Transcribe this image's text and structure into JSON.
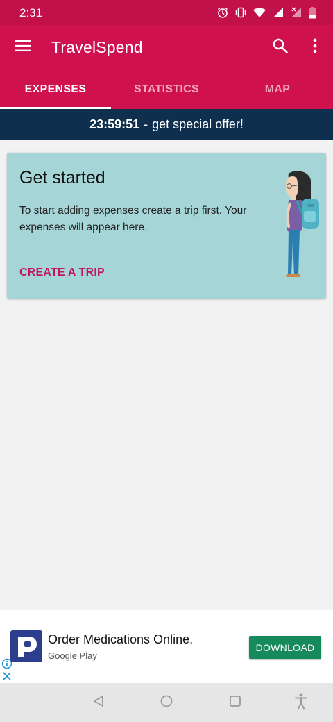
{
  "status_bar": {
    "time": "2:31",
    "icons": [
      "alarm-icon",
      "vibrate-icon",
      "wifi-icon",
      "cell-signal-icon",
      "cell-signal-no-data-icon",
      "battery-low-icon"
    ]
  },
  "app_bar": {
    "title": "TravelSpend",
    "icons": [
      "menu-icon",
      "search-icon",
      "more-vert-icon"
    ]
  },
  "tabs": [
    {
      "label": "EXPENSES",
      "active": true
    },
    {
      "label": "STATISTICS",
      "active": false
    },
    {
      "label": "MAP",
      "active": false
    }
  ],
  "offer": {
    "timer": "23:59:51",
    "separator": "-",
    "text": "get special offer!"
  },
  "card": {
    "title": "Get started",
    "body": "To start adding expenses create a trip first. Your expenses will appear here.",
    "action": "CREATE A TRIP",
    "illustration": "traveler-with-backpack"
  },
  "ad": {
    "title": "Order Medications Online.",
    "subtitle": "Google Play",
    "button": "DOWNLOAD"
  },
  "nav": {
    "icons": [
      "back-icon",
      "home-icon",
      "recents-icon",
      "accessibility-icon"
    ]
  },
  "colors": {
    "primary": "#d0114f",
    "status_bar": "#c2104a",
    "offer_bar": "#0f2f4f",
    "card_bg": "#a6d5d8",
    "accent_text": "#c2185b",
    "ad_button": "#178a5c"
  }
}
